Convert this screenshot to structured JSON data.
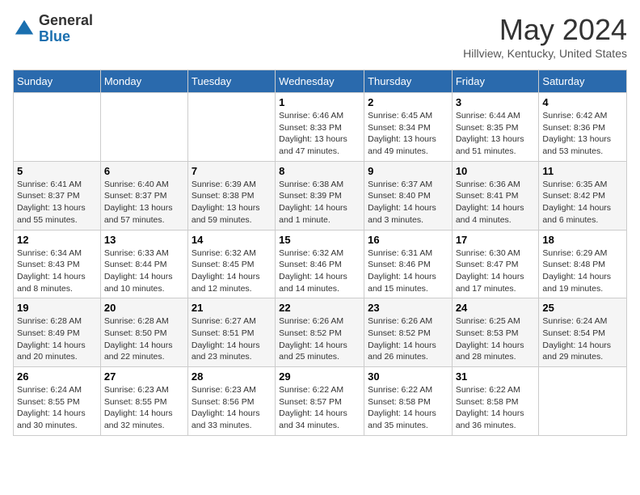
{
  "header": {
    "logo_general": "General",
    "logo_blue": "Blue",
    "title": "May 2024",
    "location": "Hillview, Kentucky, United States"
  },
  "days_of_week": [
    "Sunday",
    "Monday",
    "Tuesday",
    "Wednesday",
    "Thursday",
    "Friday",
    "Saturday"
  ],
  "weeks": [
    [
      {
        "day": "",
        "info": ""
      },
      {
        "day": "",
        "info": ""
      },
      {
        "day": "",
        "info": ""
      },
      {
        "day": "1",
        "info": "Sunrise: 6:46 AM\nSunset: 8:33 PM\nDaylight: 13 hours and 47 minutes."
      },
      {
        "day": "2",
        "info": "Sunrise: 6:45 AM\nSunset: 8:34 PM\nDaylight: 13 hours and 49 minutes."
      },
      {
        "day": "3",
        "info": "Sunrise: 6:44 AM\nSunset: 8:35 PM\nDaylight: 13 hours and 51 minutes."
      },
      {
        "day": "4",
        "info": "Sunrise: 6:42 AM\nSunset: 8:36 PM\nDaylight: 13 hours and 53 minutes."
      }
    ],
    [
      {
        "day": "5",
        "info": "Sunrise: 6:41 AM\nSunset: 8:37 PM\nDaylight: 13 hours and 55 minutes."
      },
      {
        "day": "6",
        "info": "Sunrise: 6:40 AM\nSunset: 8:37 PM\nDaylight: 13 hours and 57 minutes."
      },
      {
        "day": "7",
        "info": "Sunrise: 6:39 AM\nSunset: 8:38 PM\nDaylight: 13 hours and 59 minutes."
      },
      {
        "day": "8",
        "info": "Sunrise: 6:38 AM\nSunset: 8:39 PM\nDaylight: 14 hours and 1 minute."
      },
      {
        "day": "9",
        "info": "Sunrise: 6:37 AM\nSunset: 8:40 PM\nDaylight: 14 hours and 3 minutes."
      },
      {
        "day": "10",
        "info": "Sunrise: 6:36 AM\nSunset: 8:41 PM\nDaylight: 14 hours and 4 minutes."
      },
      {
        "day": "11",
        "info": "Sunrise: 6:35 AM\nSunset: 8:42 PM\nDaylight: 14 hours and 6 minutes."
      }
    ],
    [
      {
        "day": "12",
        "info": "Sunrise: 6:34 AM\nSunset: 8:43 PM\nDaylight: 14 hours and 8 minutes."
      },
      {
        "day": "13",
        "info": "Sunrise: 6:33 AM\nSunset: 8:44 PM\nDaylight: 14 hours and 10 minutes."
      },
      {
        "day": "14",
        "info": "Sunrise: 6:32 AM\nSunset: 8:45 PM\nDaylight: 14 hours and 12 minutes."
      },
      {
        "day": "15",
        "info": "Sunrise: 6:32 AM\nSunset: 8:46 PM\nDaylight: 14 hours and 14 minutes."
      },
      {
        "day": "16",
        "info": "Sunrise: 6:31 AM\nSunset: 8:46 PM\nDaylight: 14 hours and 15 minutes."
      },
      {
        "day": "17",
        "info": "Sunrise: 6:30 AM\nSunset: 8:47 PM\nDaylight: 14 hours and 17 minutes."
      },
      {
        "day": "18",
        "info": "Sunrise: 6:29 AM\nSunset: 8:48 PM\nDaylight: 14 hours and 19 minutes."
      }
    ],
    [
      {
        "day": "19",
        "info": "Sunrise: 6:28 AM\nSunset: 8:49 PM\nDaylight: 14 hours and 20 minutes."
      },
      {
        "day": "20",
        "info": "Sunrise: 6:28 AM\nSunset: 8:50 PM\nDaylight: 14 hours and 22 minutes."
      },
      {
        "day": "21",
        "info": "Sunrise: 6:27 AM\nSunset: 8:51 PM\nDaylight: 14 hours and 23 minutes."
      },
      {
        "day": "22",
        "info": "Sunrise: 6:26 AM\nSunset: 8:52 PM\nDaylight: 14 hours and 25 minutes."
      },
      {
        "day": "23",
        "info": "Sunrise: 6:26 AM\nSunset: 8:52 PM\nDaylight: 14 hours and 26 minutes."
      },
      {
        "day": "24",
        "info": "Sunrise: 6:25 AM\nSunset: 8:53 PM\nDaylight: 14 hours and 28 minutes."
      },
      {
        "day": "25",
        "info": "Sunrise: 6:24 AM\nSunset: 8:54 PM\nDaylight: 14 hours and 29 minutes."
      }
    ],
    [
      {
        "day": "26",
        "info": "Sunrise: 6:24 AM\nSunset: 8:55 PM\nDaylight: 14 hours and 30 minutes."
      },
      {
        "day": "27",
        "info": "Sunrise: 6:23 AM\nSunset: 8:55 PM\nDaylight: 14 hours and 32 minutes."
      },
      {
        "day": "28",
        "info": "Sunrise: 6:23 AM\nSunset: 8:56 PM\nDaylight: 14 hours and 33 minutes."
      },
      {
        "day": "29",
        "info": "Sunrise: 6:22 AM\nSunset: 8:57 PM\nDaylight: 14 hours and 34 minutes."
      },
      {
        "day": "30",
        "info": "Sunrise: 6:22 AM\nSunset: 8:58 PM\nDaylight: 14 hours and 35 minutes."
      },
      {
        "day": "31",
        "info": "Sunrise: 6:22 AM\nSunset: 8:58 PM\nDaylight: 14 hours and 36 minutes."
      },
      {
        "day": "",
        "info": ""
      }
    ]
  ]
}
